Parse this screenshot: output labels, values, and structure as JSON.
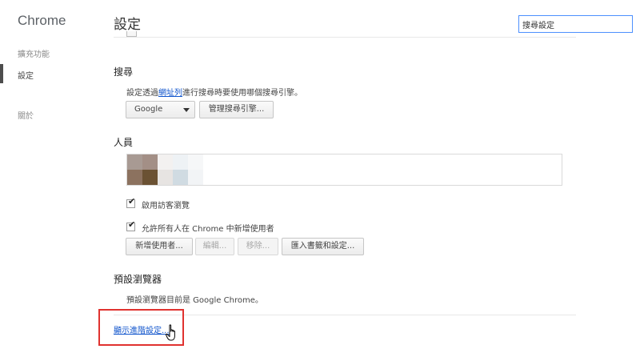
{
  "sidebar": {
    "brand": "Chrome",
    "items": [
      {
        "label": "擴充功能"
      },
      {
        "label": "設定"
      },
      {
        "label": "關於"
      }
    ]
  },
  "header": {
    "title": "設定",
    "search_value": "搜尋設定"
  },
  "search_section": {
    "title": "搜尋",
    "desc_before": "設定透過",
    "desc_link": "網址列",
    "desc_after": "進行搜尋時要使用哪個搜尋引擎。",
    "engine_selected": "Google",
    "manage_button": "管理搜尋引擎..."
  },
  "people_section": {
    "title": "人員",
    "guest_label": "啟用訪客瀏覽",
    "guest_checked": true,
    "allow_label": "允許所有人在 Chrome 中新增使用者",
    "allow_checked": true,
    "buttons": {
      "add": "新增使用者...",
      "edit": "編輯...",
      "remove": "移除...",
      "import": "匯入書籤和設定..."
    }
  },
  "default_browser_section": {
    "title": "預設瀏覽器",
    "desc": "預設瀏覽器目前是 Google Chrome。"
  },
  "advanced_link": "顯示進階設定...",
  "colors": {
    "link": "#1155cc",
    "highlight": "#e0322f"
  },
  "icons": [
    "dropdown-arrow-icon",
    "checkmark-icon",
    "hand-cursor-icon"
  ]
}
